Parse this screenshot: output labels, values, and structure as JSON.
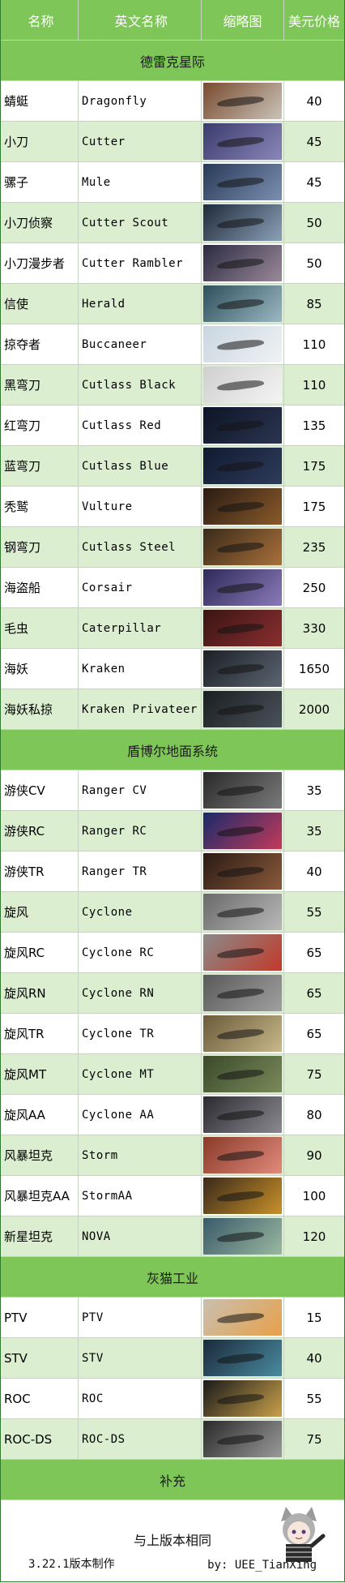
{
  "header": {
    "name": "名称",
    "english": "英文名称",
    "thumb": "缩略图",
    "price": "美元价格"
  },
  "sections": [
    {
      "title": "德雷克星际",
      "rows": [
        {
          "name": "蜻蜓",
          "english": "Dragonfly",
          "price": "40",
          "thumb": [
            "#7a4a2e",
            "#c9c3b8"
          ]
        },
        {
          "name": "小刀",
          "english": "Cutter",
          "price": "45",
          "thumb": [
            "#3b3b6e",
            "#8a86b8"
          ]
        },
        {
          "name": "骡子",
          "english": "Mule",
          "price": "45",
          "thumb": [
            "#283a58",
            "#7b8fb0"
          ]
        },
        {
          "name": "小刀侦察",
          "english": "Cutter Scout",
          "price": "50",
          "thumb": [
            "#1f2a3a",
            "#8ba0b8"
          ]
        },
        {
          "name": "小刀漫步者",
          "english": "Cutter Rambler",
          "price": "50",
          "thumb": [
            "#2c2a40",
            "#9a8a9a"
          ]
        },
        {
          "name": "信使",
          "english": "Herald",
          "price": "85",
          "thumb": [
            "#2e4f5c",
            "#9ab8c2"
          ]
        },
        {
          "name": "掠夺者",
          "english": "Buccaneer",
          "price": "110",
          "thumb": [
            "#c9d6e0",
            "#f0f2f4"
          ]
        },
        {
          "name": "黑弯刀",
          "english": "Cutlass Black",
          "price": "110",
          "thumb": [
            "#cfcfcf",
            "#f4f4f4"
          ]
        },
        {
          "name": "红弯刀",
          "english": "Cutlass Red",
          "price": "135",
          "thumb": [
            "#0d1426",
            "#2b3550"
          ]
        },
        {
          "name": "蓝弯刀",
          "english": "Cutlass Blue",
          "price": "175",
          "thumb": [
            "#101a30",
            "#2e3b5a"
          ]
        },
        {
          "name": "秃鹫",
          "english": "Vulture",
          "price": "175",
          "thumb": [
            "#2a1c14",
            "#8a5a2a"
          ]
        },
        {
          "name": "钢弯刀",
          "english": "Cutlass Steel",
          "price": "235",
          "thumb": [
            "#3a2a1a",
            "#a8703a"
          ]
        },
        {
          "name": "海盗船",
          "english": "Corsair",
          "price": "250",
          "thumb": [
            "#2e2a5a",
            "#8a7ab8"
          ]
        },
        {
          "name": "毛虫",
          "english": "Caterpillar",
          "price": "330",
          "thumb": [
            "#3a1414",
            "#8a2e2e"
          ]
        },
        {
          "name": "海妖",
          "english": "Kraken",
          "price": "1650",
          "thumb": [
            "#1c2026",
            "#5a6470"
          ]
        },
        {
          "name": "海妖私掠",
          "english": "Kraken Privateer",
          "price": "2000",
          "thumb": [
            "#1a1e22",
            "#4a525a"
          ]
        }
      ]
    },
    {
      "title": "盾博尔地面系统",
      "rows": [
        {
          "name": "游侠CV",
          "english": "Ranger CV",
          "price": "35",
          "thumb": [
            "#2a2a2a",
            "#7a7a7a"
          ]
        },
        {
          "name": "游侠RC",
          "english": "Ranger RC",
          "price": "35",
          "thumb": [
            "#1a2a6a",
            "#c23a5a"
          ]
        },
        {
          "name": "游侠TR",
          "english": "Ranger TR",
          "price": "40",
          "thumb": [
            "#2a1a14",
            "#8a5a3a"
          ]
        },
        {
          "name": "旋风",
          "english": "Cyclone",
          "price": "55",
          "thumb": [
            "#6a6a6a",
            "#b8b8b8"
          ]
        },
        {
          "name": "旋风RC",
          "english": "Cyclone RC",
          "price": "65",
          "thumb": [
            "#8a8a8a",
            "#c23a2a"
          ]
        },
        {
          "name": "旋风RN",
          "english": "Cyclone RN",
          "price": "65",
          "thumb": [
            "#5a5a5a",
            "#a0a0a0"
          ]
        },
        {
          "name": "旋风TR",
          "english": "Cyclone TR",
          "price": "65",
          "thumb": [
            "#6a5a3a",
            "#c8b88a"
          ]
        },
        {
          "name": "旋风MT",
          "english": "Cyclone MT",
          "price": "75",
          "thumb": [
            "#3a4a2a",
            "#7a8a5a"
          ]
        },
        {
          "name": "旋风AA",
          "english": "Cyclone AA",
          "price": "80",
          "thumb": [
            "#2a2a30",
            "#8a8a90"
          ]
        },
        {
          "name": "风暴坦克",
          "english": "Storm",
          "price": "90",
          "thumb": [
            "#8a3a2a",
            "#e08a7a"
          ]
        },
        {
          "name": "风暴坦克AA",
          "english": "StormAA",
          "price": "100",
          "thumb": [
            "#3a2a1a",
            "#c8902a"
          ]
        },
        {
          "name": "新星坦克",
          "english": "NOVA",
          "price": "120",
          "thumb": [
            "#3a5a6a",
            "#9ab8a0"
          ]
        }
      ]
    },
    {
      "title": "灰猫工业",
      "rows": [
        {
          "name": "PTV",
          "english": "PTV",
          "price": "15",
          "thumb": [
            "#c8c0b0",
            "#e8a04a"
          ]
        },
        {
          "name": "STV",
          "english": "STV",
          "price": "40",
          "thumb": [
            "#1a2a3a",
            "#4a8aa0"
          ]
        },
        {
          "name": "ROC",
          "english": "ROC",
          "price": "55",
          "thumb": [
            "#1a1a1a",
            "#c8a04a"
          ]
        },
        {
          "name": "ROC-DS",
          "english": "ROC-DS",
          "price": "75",
          "thumb": [
            "#2a2a2a",
            "#9a9a9a"
          ]
        }
      ]
    }
  ],
  "supplement": {
    "title": "补充",
    "note": "与上版本相同",
    "version": "3.22.1版本制作",
    "author": "by: UEE_TianXing"
  }
}
